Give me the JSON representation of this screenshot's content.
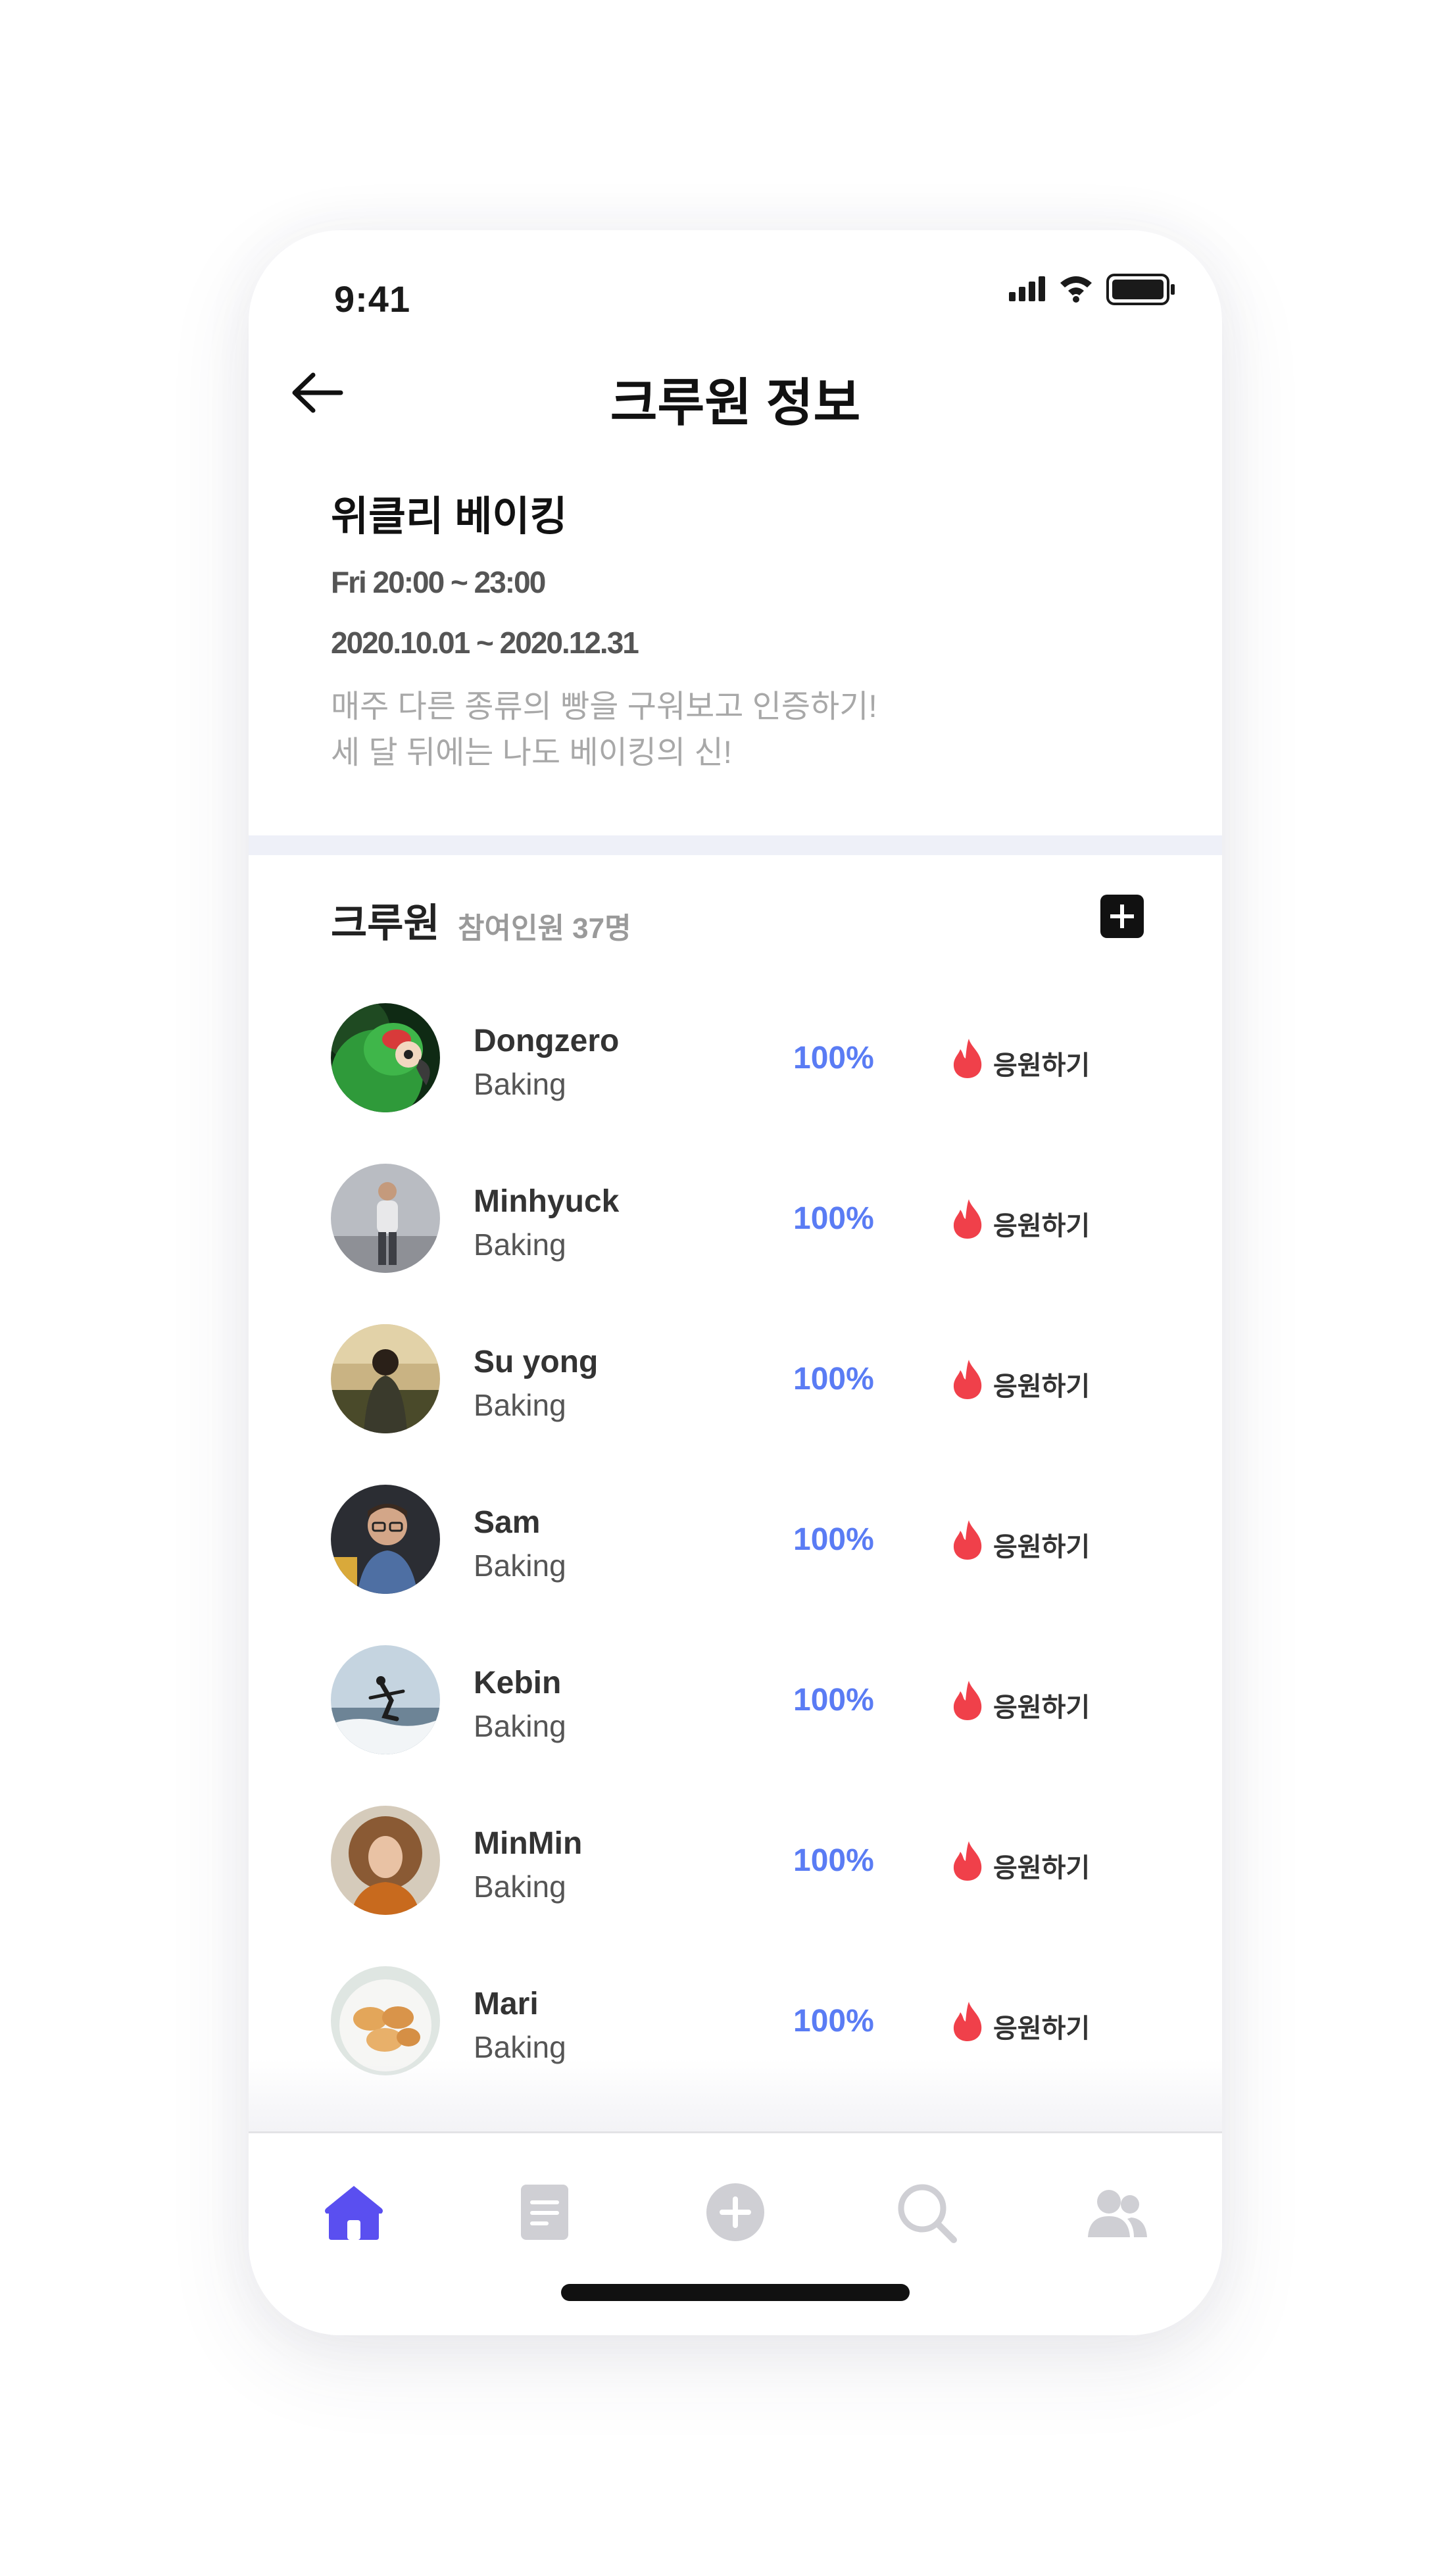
{
  "status_bar": {
    "time": "9:41"
  },
  "header": {
    "title": "크루원 정보"
  },
  "crew": {
    "name": "위클리 베이킹",
    "schedule": "Fri 20:00 ~ 23:00",
    "period": "2020.10.01 ~ 2020.12.31",
    "description_line1": "매주 다른 종류의 빵을 구워보고 인증하기!",
    "description_line2": "세 달 뒤에는 나도 베이킹의 신!"
  },
  "members_section": {
    "title": "크루원",
    "count_label": "참여인원 37명"
  },
  "members": [
    {
      "name": "Dongzero",
      "group": "Baking",
      "progress": "100%",
      "cheer_label": "응원하기"
    },
    {
      "name": "Minhyuck",
      "group": "Baking",
      "progress": "100%",
      "cheer_label": "응원하기"
    },
    {
      "name": "Su yong",
      "group": "Baking",
      "progress": "100%",
      "cheer_label": "응원하기"
    },
    {
      "name": "Sam",
      "group": "Baking",
      "progress": "100%",
      "cheer_label": "응원하기"
    },
    {
      "name": "Kebin",
      "group": "Baking",
      "progress": "100%",
      "cheer_label": "응원하기"
    },
    {
      "name": "MinMin",
      "group": "Baking",
      "progress": "100%",
      "cheer_label": "응원하기"
    },
    {
      "name": "Mari",
      "group": "Baking",
      "progress": "100%",
      "cheer_label": "응원하기"
    }
  ],
  "bottom_nav": {
    "items": [
      "home-icon",
      "document-icon",
      "add-circle-icon",
      "search-icon",
      "people-icon"
    ],
    "active": "home-icon"
  },
  "colors": {
    "accent": "#5a4ff0",
    "progress": "#5a7cf4",
    "cheer": "#f0404a",
    "inactive": "#cfcfd4"
  }
}
